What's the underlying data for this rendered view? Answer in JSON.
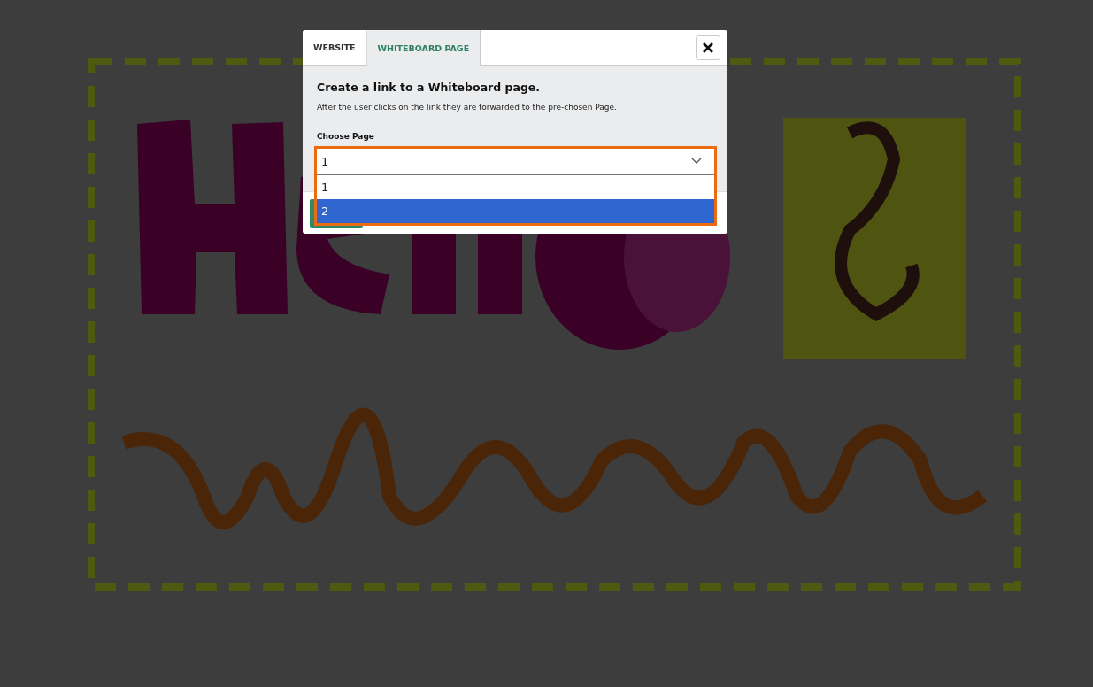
{
  "dialog": {
    "tabs": [
      {
        "label": "WEBSITE",
        "selected": false
      },
      {
        "label": "WHITEBOARD PAGE",
        "selected": true
      }
    ],
    "heading": "Create a link to a Whiteboard page.",
    "description": "After the user clicks on the link they are forwarded to the pre-chosen Page.",
    "field_label": "Choose Page",
    "select": {
      "value": "1",
      "expanded": true,
      "options": [
        {
          "label": "1",
          "highlighted": false
        },
        {
          "label": "2",
          "highlighted": true
        }
      ]
    }
  }
}
